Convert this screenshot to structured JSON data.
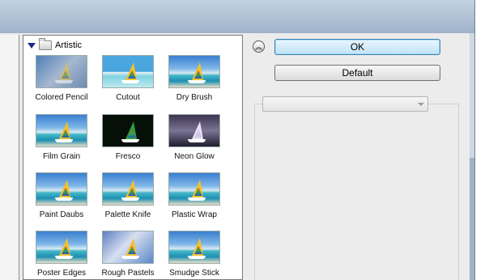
{
  "gallery": {
    "folder_label": "Artistic",
    "filters": [
      {
        "label": "Colored Pencil",
        "style": "colored"
      },
      {
        "label": "Cutout",
        "style": "cutout"
      },
      {
        "label": "Dry Brush",
        "style": "normal"
      },
      {
        "label": "Film Grain",
        "style": "normal"
      },
      {
        "label": "Fresco",
        "style": "fresco"
      },
      {
        "label": "Neon Glow",
        "style": "neon"
      },
      {
        "label": "Paint Daubs",
        "style": "normal"
      },
      {
        "label": "Palette Knife",
        "style": "normal"
      },
      {
        "label": "Plastic Wrap",
        "style": "normal"
      },
      {
        "label": "Poster Edges",
        "style": "normal"
      },
      {
        "label": "Rough Pastels",
        "style": "rough"
      },
      {
        "label": "Smudge Stick",
        "style": "normal"
      }
    ]
  },
  "buttons": {
    "ok_label": "OK",
    "default_label": "Default"
  },
  "options": {
    "filter_select_value": ""
  },
  "icons": {
    "collapse": "double-chevron-up-icon",
    "folder": "folder-icon",
    "expand": "triangle-down-icon"
  }
}
